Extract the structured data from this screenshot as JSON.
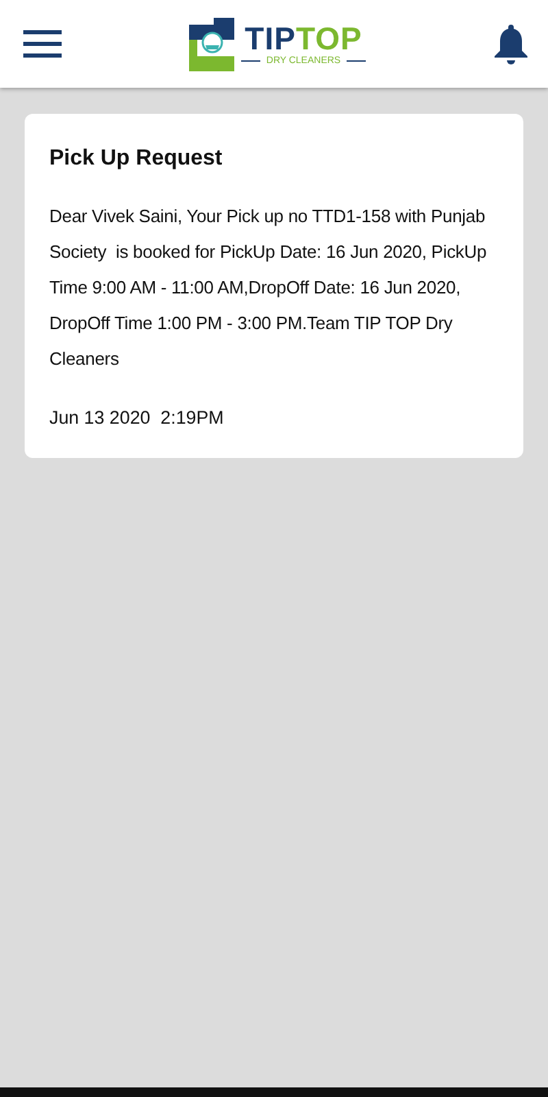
{
  "header": {
    "logo": {
      "parts": [
        {
          "text": "TIP",
          "color": "#1b3d6e"
        },
        {
          "text": "TOP",
          "color": "#7cb82f"
        }
      ],
      "tagline": "DRY CLEANERS"
    }
  },
  "notifications": [
    {
      "title": "Pick Up Request",
      "message": "Dear Vivek Saini, Your Pick up no TTD1-158 with Punjab Society  is booked for PickUp Date: 16 Jun 2020, PickUp Time 9:00 AM - 11:00 AM,DropOff Date: 16 Jun 2020, DropOff Time 1:00 PM - 3:00 PM.Team TIP TOP Dry Cleaners",
      "time": "Jun 13 2020  2:19PM"
    }
  ]
}
